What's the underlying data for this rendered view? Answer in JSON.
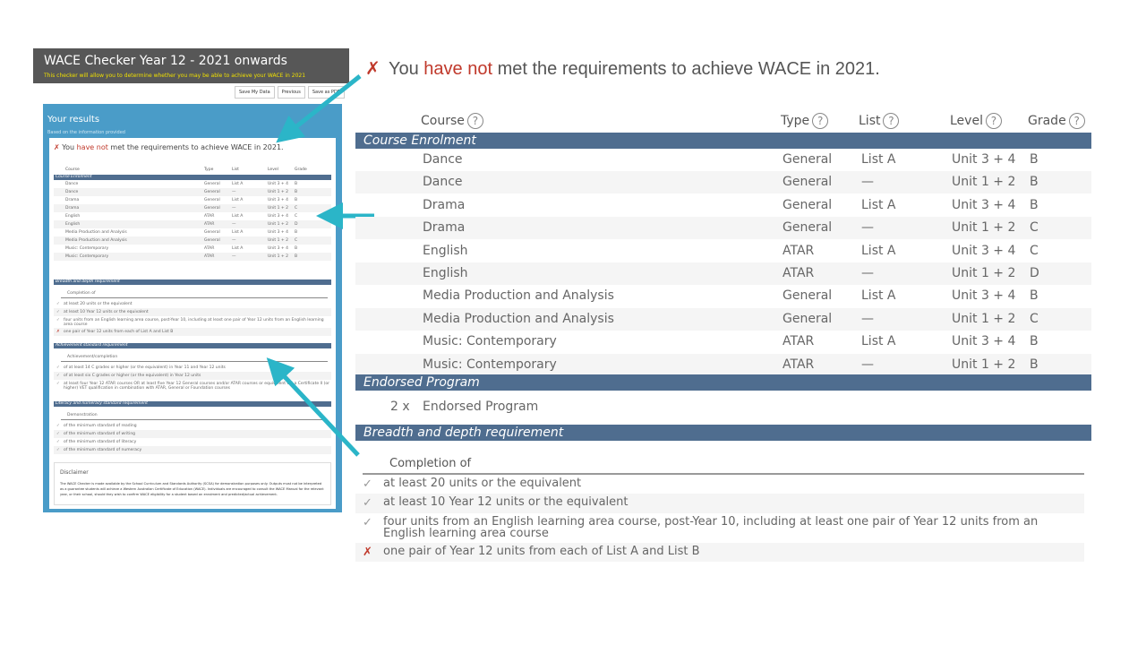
{
  "thumbnail": {
    "title": "WACE Checker Year 12 - 2021 onwards",
    "subtitle": "This checker will allow you to determine whether you may be able to achieve your WACE in 2021",
    "toolbar": [
      "Save My Data",
      "Previous",
      "Save as PDF"
    ],
    "results_title": "Your results",
    "results_sub": "Based on the information provided",
    "status_prefix": "You",
    "status_red": "have not",
    "status_suffix": "met the requirements to achieve WACE in 2021.",
    "headers": [
      "Course",
      "Type",
      "List",
      "Level",
      "Grade"
    ],
    "section_course": "Course Enrolment",
    "rows": [
      [
        "Dance",
        "General",
        "List A",
        "Unit 3 + 4",
        "B"
      ],
      [
        "Dance",
        "General",
        "—",
        "Unit 1 + 2",
        "B"
      ],
      [
        "Drama",
        "General",
        "List A",
        "Unit 3 + 4",
        "B"
      ],
      [
        "Drama",
        "General",
        "—",
        "Unit 1 + 2",
        "C"
      ],
      [
        "English",
        "ATAR",
        "List A",
        "Unit 3 + 4",
        "C"
      ],
      [
        "English",
        "ATAR",
        "—",
        "Unit 1 + 2",
        "D"
      ],
      [
        "Media Production and Analysis",
        "General",
        "List A",
        "Unit 3 + 4",
        "B"
      ],
      [
        "Media Production and Analysis",
        "General",
        "—",
        "Unit 1 + 2",
        "C"
      ],
      [
        "Music: Contemporary",
        "ATAR",
        "List A",
        "Unit 3 + 4",
        "B"
      ],
      [
        "Music: Contemporary",
        "ATAR",
        "—",
        "Unit 1 + 2",
        "B"
      ]
    ],
    "section_breadth": "Breadth and depth requirement",
    "completion_of": "Completion of",
    "breadth_items": [
      [
        "✓",
        "at least 20 units or the equivalent"
      ],
      [
        "✓",
        "at least 10 Year 12 units or the equivalent"
      ],
      [
        "✓",
        "four units from an English learning area course, post-Year 10, including at least one pair of Year 12 units from an English learning area course"
      ],
      [
        "✗",
        "one pair of Year 12 units from each of List A and List B"
      ]
    ],
    "section_achievement": "Achievement standard requirement",
    "achievement_head": "Achievement/completion",
    "achievement_items": [
      [
        "✓",
        "of at least 14 C grades or higher (or the equivalent) in Year 11 and Year 12 units"
      ],
      [
        "✓",
        "of at least six C grades or higher (or the equivalent) in Year 12 units"
      ],
      [
        "✓",
        "at least four Year 12 ATAR courses OR at least five Year 12 General courses and/or ATAR courses or equivalent OR a Certificate II (or higher) VET qualification in combination with ATAR, General or Foundation courses"
      ]
    ],
    "section_literacy": "Literacy and numeracy standard requirement",
    "demonstration": "Demonstration",
    "literacy_items": [
      [
        "✓",
        "of the minimum standard of reading"
      ],
      [
        "✓",
        "of the minimum standard of writing"
      ],
      [
        "✓",
        "of the minimum standard of literacy"
      ],
      [
        "✓",
        "of the minimum standard of numeracy"
      ]
    ],
    "disclaimer_title": "Disclaimer",
    "disclaimer_text": "The WACE Checker is made available by the School Curriculum and Standards Authority (SCSA) for demonstration purposes only. Outputs must not be interpreted as a guarantee students will achieve a Western Australian Certificate of Education (WACE). Individuals are encouraged to consult the WACE Manual for the relevant year, or their school, should they wish to confirm WACE eligibility for a student based on enrolment and predicted/actual achievement."
  },
  "main": {
    "status_mark": "✗",
    "status_prefix": "You",
    "status_red": "have not",
    "status_suffix": "met the requirements to achieve WACE in 2021.",
    "headers": {
      "course": "Course",
      "type": "Type",
      "list": "List",
      "level": "Level",
      "grade": "Grade"
    },
    "section_course": "Course Enrolment",
    "rows": [
      {
        "course": "Dance",
        "type": "General",
        "list": "List A",
        "level": "Unit 3 + 4",
        "grade": "B"
      },
      {
        "course": "Dance",
        "type": "General",
        "list": "—",
        "level": "Unit 1 + 2",
        "grade": "B"
      },
      {
        "course": "Drama",
        "type": "General",
        "list": "List A",
        "level": "Unit 3 + 4",
        "grade": "B"
      },
      {
        "course": "Drama",
        "type": "General",
        "list": "—",
        "level": "Unit 1 + 2",
        "grade": "C"
      },
      {
        "course": "English",
        "type": "ATAR",
        "list": "List A",
        "level": "Unit 3 + 4",
        "grade": "C"
      },
      {
        "course": "English",
        "type": "ATAR",
        "list": "—",
        "level": "Unit 1 + 2",
        "grade": "D"
      },
      {
        "course": "Media Production and Analysis",
        "type": "General",
        "list": "List A",
        "level": "Unit 3 + 4",
        "grade": "B"
      },
      {
        "course": "Media Production and Analysis",
        "type": "General",
        "list": "—",
        "level": "Unit 1 + 2",
        "grade": "C"
      },
      {
        "course": "Music: Contemporary",
        "type": "ATAR",
        "list": "List A",
        "level": "Unit 3 + 4",
        "grade": "B"
      },
      {
        "course": "Music: Contemporary",
        "type": "ATAR",
        "list": "—",
        "level": "Unit 1 + 2",
        "grade": "B"
      }
    ],
    "section_endorsed": "Endorsed Program",
    "endorsed": {
      "count": "2 x",
      "name": "Endorsed Program"
    },
    "section_breadth": "Breadth and depth requirement",
    "completion_of": "Completion of",
    "breadth_items": [
      {
        "mark": "✓",
        "ok": true,
        "text": "at least 20 units or the equivalent"
      },
      {
        "mark": "✓",
        "ok": true,
        "text": "at least 10 Year 12 units or the equivalent"
      },
      {
        "mark": "✓",
        "ok": true,
        "text": "four units from an English learning area course, post-Year 10, including at least one pair of Year 12 units from an English learning area course"
      },
      {
        "mark": "✗",
        "ok": false,
        "text": "one pair of Year 12 units from each of List A and List B"
      }
    ]
  },
  "colors": {
    "section_bar": "#4f6d8f",
    "frame_blue": "#4a9cc8",
    "arrow": "#2bb5c8",
    "fail_red": "#c0392b"
  }
}
